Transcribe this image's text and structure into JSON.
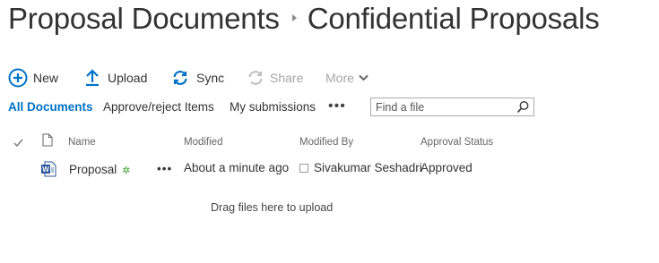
{
  "breadcrumb": {
    "parent": "Proposal Documents",
    "current": "Confidential Proposals"
  },
  "commands": {
    "new": "New",
    "upload": "Upload",
    "sync": "Sync",
    "share": "Share",
    "more": "More"
  },
  "views": {
    "all_documents": "All Documents",
    "approve_reject": "Approve/reject Items",
    "my_submissions": "My submissions",
    "more_dots": "•••"
  },
  "search": {
    "placeholder": "Find a file"
  },
  "columns": {
    "name": "Name",
    "modified": "Modified",
    "modified_by": "Modified By",
    "approval_status": "Approval Status"
  },
  "rows": [
    {
      "name": "Proposal",
      "new_marker": "✲",
      "menu": "•••",
      "modified": "About a minute ago",
      "modified_by": "Sivakumar Seshadri",
      "approval_status": "Approved"
    }
  ],
  "drop_hint": "Drag files here to upload",
  "colors": {
    "accent": "#0072c6",
    "new_marker": "#3b9e2a",
    "disabled": "#a6a6a6"
  },
  "icons": {
    "new": "plus-circle-icon",
    "upload": "upload-arrow-icon",
    "sync": "sync-icon",
    "share": "share-icon",
    "more": "chevron-down-icon",
    "search": "search-icon",
    "file": "word-document-icon"
  }
}
